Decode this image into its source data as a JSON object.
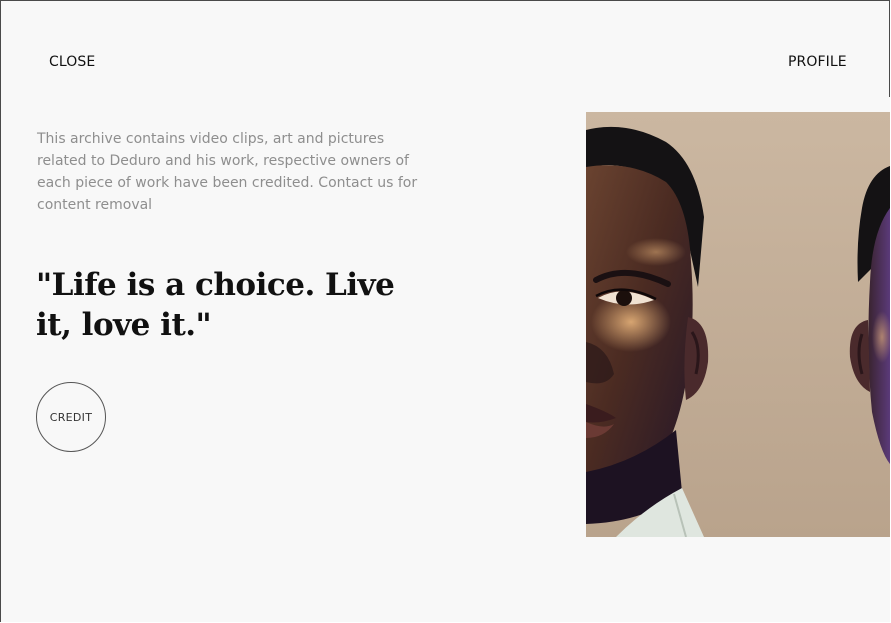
{
  "header": {
    "close_label": "CLOSE",
    "profile_label": "PROFILE"
  },
  "archive": {
    "description": "This archive contains video clips, art and pictures related to Deduro and his work, respective owners of each piece of work have been credited. Contact us for content removal"
  },
  "quote": {
    "text": "\"Life is a choice. Live it, love it.\""
  },
  "credit": {
    "label": "CREDIT"
  },
  "colors": {
    "background": "#f8f8f8",
    "text_primary": "#111111",
    "text_muted": "#8e8e8e",
    "artwork_background": "#c2ad94"
  }
}
